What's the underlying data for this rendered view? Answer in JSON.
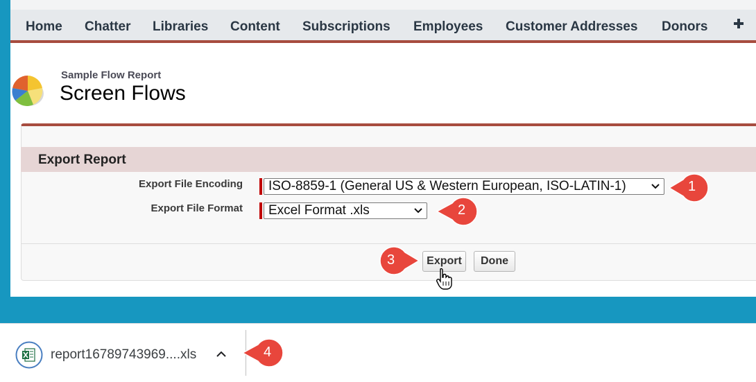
{
  "nav": {
    "tabs": [
      "Home",
      "Chatter",
      "Libraries",
      "Content",
      "Subscriptions",
      "Employees",
      "Customer Addresses",
      "Donors"
    ],
    "plus_icon": "plus-icon"
  },
  "header": {
    "subtitle": "Sample Flow Report",
    "title": "Screen Flows"
  },
  "export": {
    "section_title": "Export Report",
    "encoding_label": "Export File Encoding",
    "encoding_value": "ISO-8859-1 (General US & Western European, ISO-LATIN-1)",
    "format_label": "Export File Format",
    "format_value": "Excel Format .xls",
    "export_button": "Export",
    "done_button": "Done"
  },
  "callouts": [
    "1",
    "2",
    "3",
    "4"
  ],
  "download": {
    "filename": "report16789743969....xls"
  },
  "colors": {
    "accent": "#a74c3f",
    "background": "#1797c0",
    "callout": "#e8463c",
    "required": "#c00000"
  }
}
